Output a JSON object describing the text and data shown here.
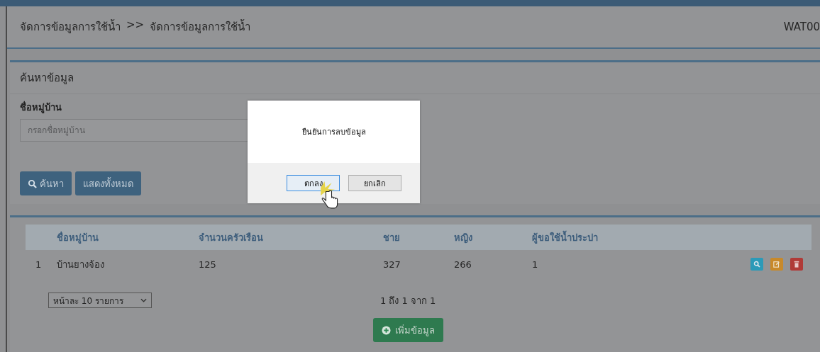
{
  "header": {
    "breadcrumb": [
      "จัดการข้อมูลการใช้น้ำ",
      ">>",
      "จัดการข้อมูลการใช้น้ำ"
    ],
    "code": "WAT00"
  },
  "search_panel": {
    "title": "ค้นหาข้อมูล",
    "field_label": "ชื่อหมู่บ้าน",
    "placeholder": "กรอกชื่อหมู่บ้าน",
    "buttons": [
      {
        "kind": "search",
        "label": "ค้นหา"
      },
      {
        "kind": "plain",
        "label": "แสดงทั้งหมด"
      }
    ]
  },
  "table": {
    "columns": [
      "",
      "ชื่อหมู่บ้าน",
      "จำนวนครัวเรือน",
      "ชาย",
      "หญิง",
      "ผู้ขอใช้น้ำประปา"
    ],
    "rows": [
      {
        "cells": [
          "1",
          "บ้านยางจ้อง",
          "125",
          "327",
          "266",
          "1"
        ],
        "actions": [
          {
            "kind": "view"
          },
          {
            "kind": "edit"
          },
          {
            "kind": "delete"
          }
        ]
      }
    ]
  },
  "pagination": {
    "page_size": "หน้าละ 10 รายการ",
    "info": "1 ถึง 1 จาก 1"
  },
  "add_button": "เพิ่มข้อมูล",
  "dialog": {
    "message": "ยืนยันการลบข้อมูล",
    "buttons": [
      {
        "label": "ตกลง",
        "selected": true
      },
      {
        "label": "ยกเลิก",
        "selected": false
      }
    ]
  }
}
